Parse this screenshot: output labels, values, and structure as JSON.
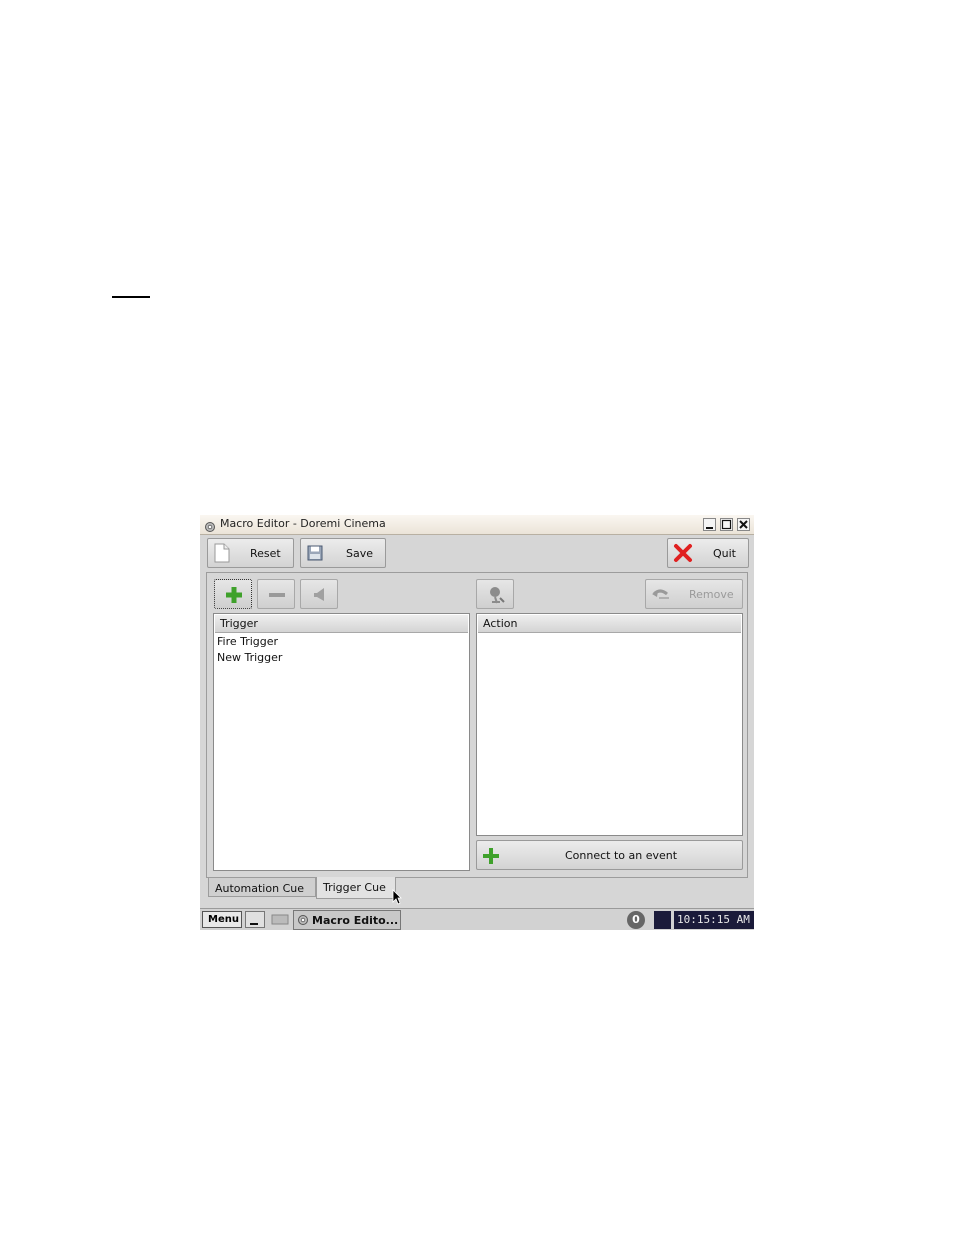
{
  "window": {
    "title": "Macro Editor - Doremi Cinema"
  },
  "toolbar": {
    "reset_label": "Reset",
    "save_label": "Save",
    "quit_label": "Quit"
  },
  "secondary_toolbar": {
    "remove_label": "Remove"
  },
  "trigger_list": {
    "header": "Trigger",
    "items": [
      "Fire Trigger",
      "New Trigger"
    ]
  },
  "action_list": {
    "header": "Action",
    "items": []
  },
  "connect_button": {
    "label": "Connect to an event"
  },
  "tabs": [
    {
      "label": "Automation Cue",
      "active": false
    },
    {
      "label": "Trigger Cue",
      "active": true
    }
  ],
  "taskbar": {
    "menu_label": "Menu",
    "task_label": "Macro Edito...",
    "status_indicator": "0",
    "clock": "10:15:15 AM"
  },
  "colors": {
    "add_green": "#3fa12b",
    "quit_red": "#e02020",
    "clock_bg": "#1b1b3a"
  }
}
